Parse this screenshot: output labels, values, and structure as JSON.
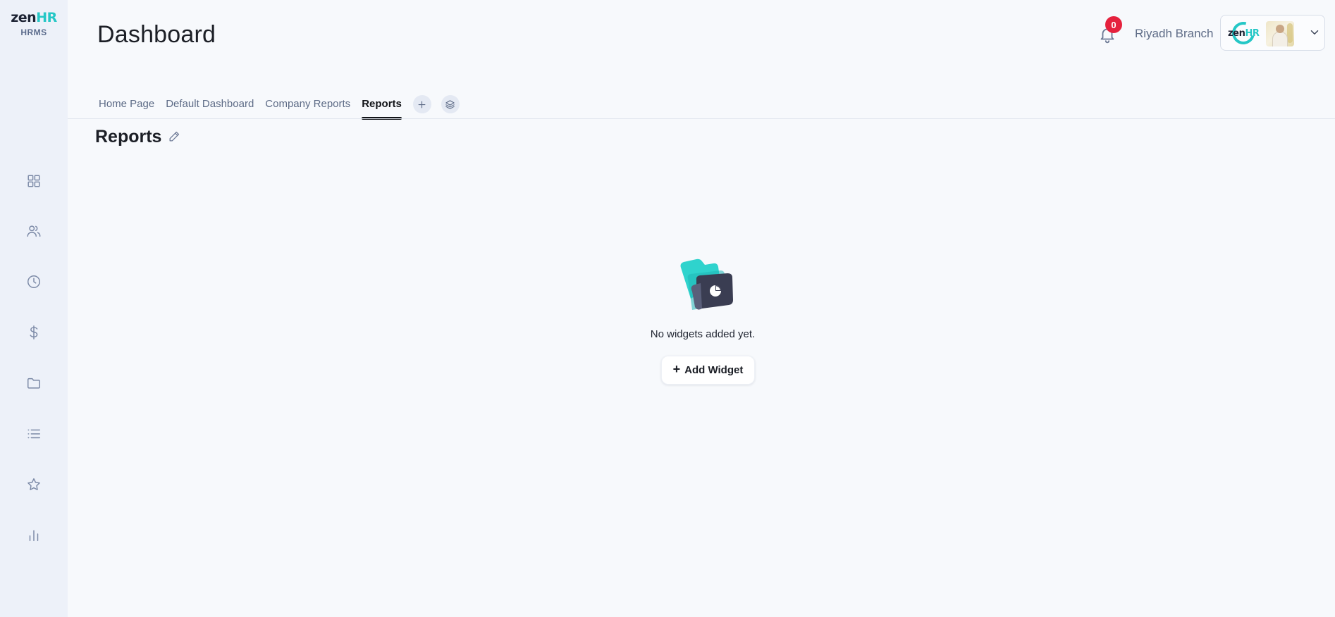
{
  "brand": {
    "logo_prefix": "zen",
    "logo_suffix": "HR",
    "logo_subtitle": "HRMS",
    "accent_color": "#25c7c6"
  },
  "sidebar": {
    "items": [
      {
        "name": "dashboard",
        "icon": "grid-icon"
      },
      {
        "name": "employees",
        "icon": "users-icon"
      },
      {
        "name": "time",
        "icon": "clock-icon"
      },
      {
        "name": "payroll",
        "icon": "dollar-icon"
      },
      {
        "name": "documents",
        "icon": "folder-icon"
      },
      {
        "name": "lists",
        "icon": "list-icon"
      },
      {
        "name": "favorites",
        "icon": "star-icon"
      },
      {
        "name": "reports",
        "icon": "bar-chart-icon"
      }
    ]
  },
  "header": {
    "title": "Dashboard",
    "notifications_count": "0",
    "branch": "Riyadh Branch",
    "account_logo_prefix": "zen",
    "account_logo_suffix": "HR"
  },
  "tabs": [
    {
      "label": "Home Page",
      "active": false
    },
    {
      "label": "Default Dashboard",
      "active": false
    },
    {
      "label": "Company Reports",
      "active": false
    },
    {
      "label": "Reports",
      "active": true
    }
  ],
  "section": {
    "title": "Reports"
  },
  "empty_state": {
    "message": "No widgets added yet.",
    "button_label": "Add Widget",
    "button_symbol": "+"
  }
}
